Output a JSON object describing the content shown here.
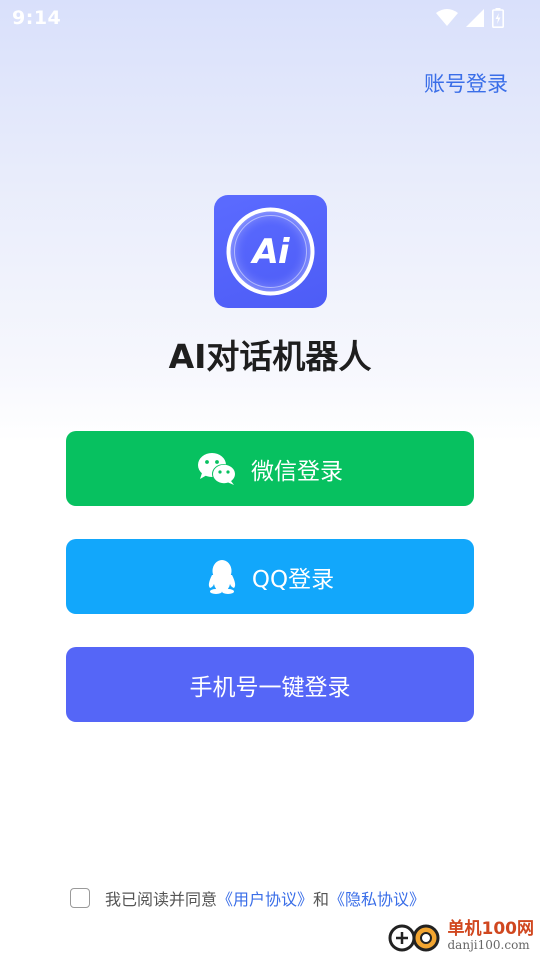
{
  "status_bar": {
    "time": "9:14",
    "icons": [
      "wifi-icon",
      "signal-icon",
      "battery-icon"
    ]
  },
  "header": {
    "account_login": "账号登录"
  },
  "app": {
    "logo_text": "Ai",
    "title": "AI对话机器人"
  },
  "buttons": {
    "wechat": {
      "label": "微信登录",
      "icon": "wechat-icon",
      "color": "#07c160"
    },
    "qq": {
      "label": "QQ登录",
      "icon": "qq-icon",
      "color": "#12a7fb"
    },
    "phone": {
      "label": "手机号一键登录",
      "color": "#5566f7"
    }
  },
  "agreement": {
    "prefix": "我已阅读并同意",
    "user_agreement": "《用户协议》",
    "and": "和",
    "privacy_agreement": "《隐私协议》",
    "checked": false
  },
  "watermark": {
    "title": "单机100网",
    "subtitle": "danji100.com"
  },
  "colors": {
    "accent": "#3a6ee8",
    "logo_bg": "#5b6bff"
  }
}
